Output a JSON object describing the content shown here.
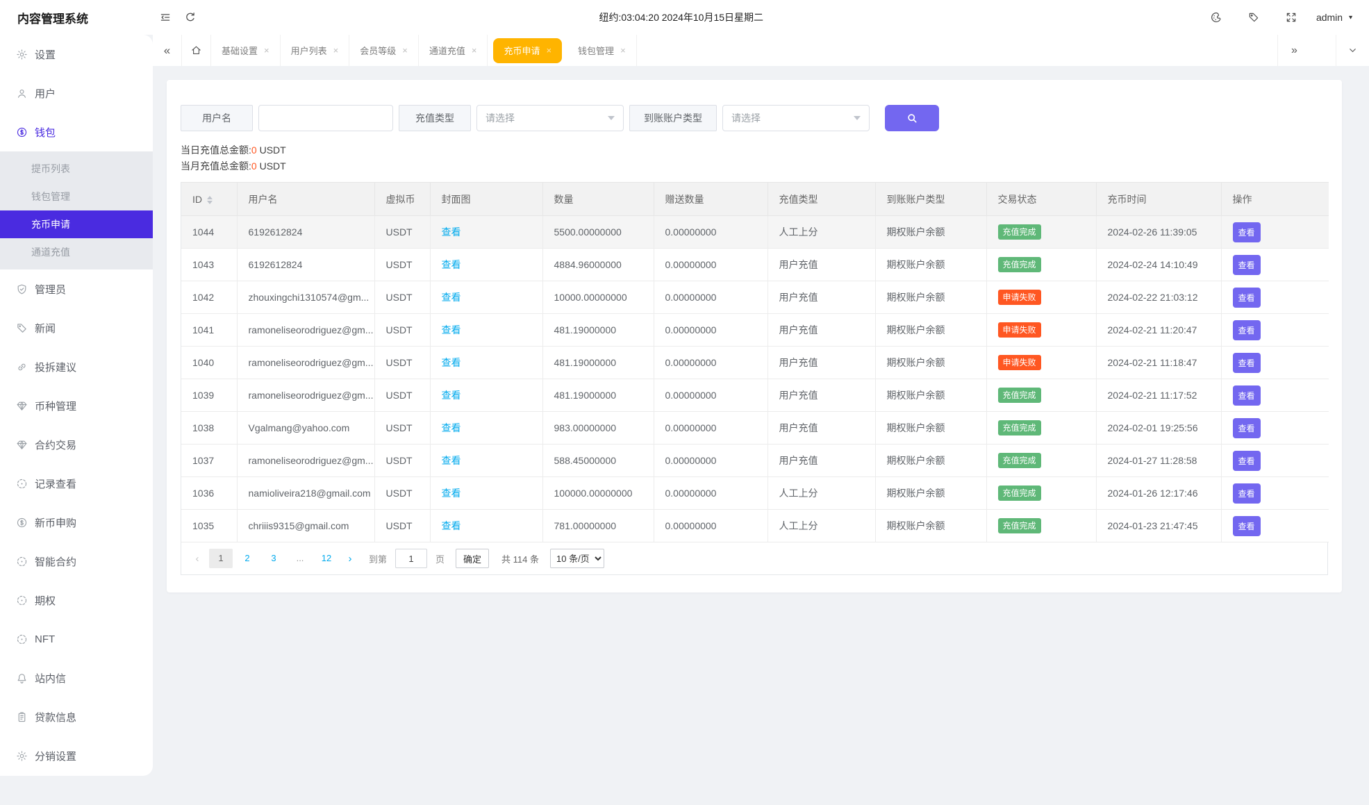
{
  "app": {
    "title": "内容管理系统",
    "time": "纽约:03:04:20 2024年10月15日星期二",
    "user": "admin"
  },
  "colors": {
    "primary": "#4a2be0",
    "accent": "#7367f0",
    "tab_active": "#ffb400",
    "success": "#5fb878",
    "danger": "#ff5722",
    "link": "#01aaed"
  },
  "icons": {
    "chevrons_left": "«",
    "chevrons_right": "»",
    "prev": "‹",
    "next": "›",
    "close": "×",
    "caret_down": "▼"
  },
  "sidebar": {
    "items": [
      {
        "key": "settings",
        "label": "设置",
        "icon": "gear"
      },
      {
        "key": "users",
        "label": "用户",
        "icon": "user"
      },
      {
        "key": "wallet",
        "label": "钱包",
        "icon": "dollar-circle",
        "active": true,
        "children": [
          {
            "label": "提币列表"
          },
          {
            "label": "钱包管理"
          },
          {
            "label": "充币申请",
            "active": true
          },
          {
            "label": "通道充值"
          }
        ]
      },
      {
        "key": "admins",
        "label": "管理员",
        "icon": "shield-check"
      },
      {
        "key": "news",
        "label": "新闻",
        "icon": "tag"
      },
      {
        "key": "feedback",
        "label": "投拆建议",
        "icon": "link"
      },
      {
        "key": "coins",
        "label": "币种管理",
        "icon": "gem"
      },
      {
        "key": "contract-trade",
        "label": "合约交易",
        "icon": "gem"
      },
      {
        "key": "records",
        "label": "记录查看",
        "icon": "dashed-circle"
      },
      {
        "key": "new-coin",
        "label": "新币申购",
        "icon": "dollar-circle"
      },
      {
        "key": "smart-contract",
        "label": "智能合约",
        "icon": "dashed-circle"
      },
      {
        "key": "options",
        "label": "期权",
        "icon": "dashed-circle"
      },
      {
        "key": "nft",
        "label": "NFT",
        "icon": "dashed-circle"
      },
      {
        "key": "messages",
        "label": "站内信",
        "icon": "bell"
      },
      {
        "key": "loans",
        "label": "贷款信息",
        "icon": "clipboard"
      },
      {
        "key": "distribution",
        "label": "分销设置",
        "icon": "gear"
      }
    ]
  },
  "tabs": [
    {
      "label": "基础设置"
    },
    {
      "label": "用户列表"
    },
    {
      "label": "会员等级"
    },
    {
      "label": "通道充值"
    },
    {
      "label": "充币申请",
      "active": true
    },
    {
      "label": "钱包管理"
    }
  ],
  "filters": {
    "username_label": "用户名",
    "username_value": "",
    "type_label": "充值类型",
    "account_label": "到账账户类型",
    "select_placeholder": "请选择"
  },
  "totals": {
    "today_label": "当日充值总金额:",
    "today_value": "0",
    "month_label": "当月充值总金额:",
    "month_value": "0",
    "unit": " USDT"
  },
  "table": {
    "columns": [
      "ID",
      "用户名",
      "虚拟币",
      "封面图",
      "数量",
      "赠送数量",
      "充值类型",
      "到账账户类型",
      "交易状态",
      "充币时间",
      "操作"
    ],
    "view_link": "查看",
    "action_label": "查看",
    "rows": [
      {
        "id": "1044",
        "username": "6192612824",
        "coin": "USDT",
        "amount": "5500.00000000",
        "gift": "0.00000000",
        "type": "人工上分",
        "account": "期权账户余额",
        "status": "充值完成",
        "status_kind": "success",
        "time": "2024-02-26 11:39:05",
        "highlight": true
      },
      {
        "id": "1043",
        "username": "6192612824",
        "coin": "USDT",
        "amount": "4884.96000000",
        "gift": "0.00000000",
        "type": "用户充值",
        "account": "期权账户余额",
        "status": "充值完成",
        "status_kind": "success",
        "time": "2024-02-24 14:10:49"
      },
      {
        "id": "1042",
        "username": "zhouxingchi1310574@gm...",
        "coin": "USDT",
        "amount": "10000.00000000",
        "gift": "0.00000000",
        "type": "用户充值",
        "account": "期权账户余额",
        "status": "申请失败",
        "status_kind": "fail",
        "time": "2024-02-22 21:03:12"
      },
      {
        "id": "1041",
        "username": "ramoneliseorodriguez@gm...",
        "coin": "USDT",
        "amount": "481.19000000",
        "gift": "0.00000000",
        "type": "用户充值",
        "account": "期权账户余额",
        "status": "申请失败",
        "status_kind": "fail",
        "time": "2024-02-21 11:20:47"
      },
      {
        "id": "1040",
        "username": "ramoneliseorodriguez@gm...",
        "coin": "USDT",
        "amount": "481.19000000",
        "gift": "0.00000000",
        "type": "用户充值",
        "account": "期权账户余额",
        "status": "申请失败",
        "status_kind": "fail",
        "time": "2024-02-21 11:18:47"
      },
      {
        "id": "1039",
        "username": "ramoneliseorodriguez@gm...",
        "coin": "USDT",
        "amount": "481.19000000",
        "gift": "0.00000000",
        "type": "用户充值",
        "account": "期权账户余额",
        "status": "充值完成",
        "status_kind": "success",
        "time": "2024-02-21 11:17:52"
      },
      {
        "id": "1038",
        "username": "Vgalmang@yahoo.com",
        "coin": "USDT",
        "amount": "983.00000000",
        "gift": "0.00000000",
        "type": "用户充值",
        "account": "期权账户余额",
        "status": "充值完成",
        "status_kind": "success",
        "time": "2024-02-01 19:25:56"
      },
      {
        "id": "1037",
        "username": "ramoneliseorodriguez@gm...",
        "coin": "USDT",
        "amount": "588.45000000",
        "gift": "0.00000000",
        "type": "用户充值",
        "account": "期权账户余额",
        "status": "充值完成",
        "status_kind": "success",
        "time": "2024-01-27 11:28:58"
      },
      {
        "id": "1036",
        "username": "namioliveira218@gmail.com",
        "coin": "USDT",
        "amount": "100000.00000000",
        "gift": "0.00000000",
        "type": "人工上分",
        "account": "期权账户余额",
        "status": "充值完成",
        "status_kind": "success",
        "time": "2024-01-26 12:17:46"
      },
      {
        "id": "1035",
        "username": "chriiis9315@gmail.com",
        "coin": "USDT",
        "amount": "781.00000000",
        "gift": "0.00000000",
        "type": "人工上分",
        "account": "期权账户余额",
        "status": "充值完成",
        "status_kind": "success",
        "time": "2024-01-23 21:47:45"
      }
    ]
  },
  "pagination": {
    "pages": [
      "1",
      "2",
      "3",
      "...",
      "12"
    ],
    "current": "1",
    "goto_label": "到第",
    "goto_value": "1",
    "page_unit": "页",
    "confirm_label": "确定",
    "total_label": "共 114 条",
    "per_page": "10 条/页"
  }
}
